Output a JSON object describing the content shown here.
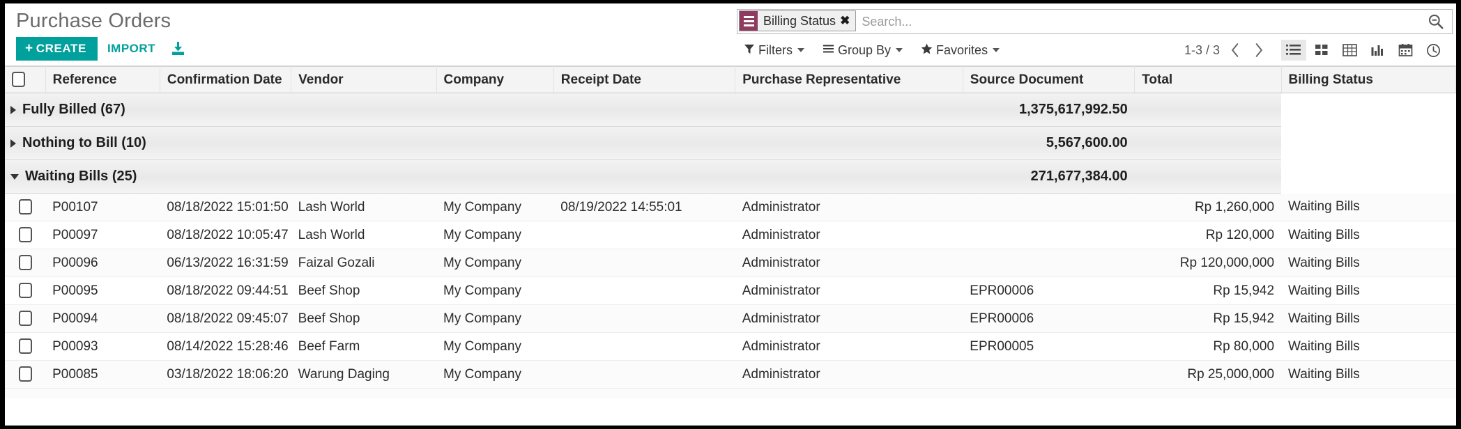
{
  "header": {
    "title": "Purchase Orders",
    "create_label": "CREATE",
    "create_plus": "+",
    "import_label": "IMPORT",
    "download_icon": "download-icon",
    "accent_color": "#00a09d"
  },
  "search": {
    "facet": {
      "label": "Billing Status",
      "remove": "✖",
      "icon": "group-by-icon",
      "icon_color": "#8f3a5f"
    },
    "placeholder": "Search...",
    "value": "",
    "magnifier_icon": "search-icon"
  },
  "toolbar": {
    "filters_label": "Filters",
    "filters_icon": "filter-funnel-icon",
    "groupby_label": "Group By",
    "groupby_icon": "group-by-icon",
    "favorites_label": "Favorites",
    "favorites_icon": "star-icon",
    "pager_range": "1-3 / 3",
    "prev_icon": "chevron-left-icon",
    "next_icon": "chevron-right-icon",
    "views": [
      {
        "name": "list-view-button",
        "icon": "list-icon",
        "active": true
      },
      {
        "name": "kanban-view-button",
        "icon": "kanban-icon",
        "active": false
      },
      {
        "name": "pivot-view-button",
        "icon": "pivot-table-icon",
        "active": false
      },
      {
        "name": "graph-view-button",
        "icon": "bar-chart-icon",
        "active": false
      },
      {
        "name": "calendar-view-button",
        "icon": "calendar-icon",
        "active": false
      },
      {
        "name": "activity-view-button",
        "icon": "clock-icon",
        "active": false
      }
    ]
  },
  "table": {
    "columns": [
      "Reference",
      "Confirmation Date",
      "Vendor",
      "Company",
      "Receipt Date",
      "Purchase Representative",
      "Source Document",
      "Total",
      "Billing Status"
    ],
    "groups": [
      {
        "label": "Fully Billed (67)",
        "total": "1,375,617,992.50",
        "expanded": false
      },
      {
        "label": "Nothing to Bill (10)",
        "total": "5,567,600.00",
        "expanded": false
      },
      {
        "label": "Waiting Bills (25)",
        "total": "271,677,384.00",
        "expanded": true
      }
    ],
    "rows": [
      {
        "reference": "P00107",
        "confirmation_date": "08/18/2022 15:01:50",
        "vendor": "Lash World",
        "company": "My Company",
        "receipt_date": "08/19/2022 14:55:01",
        "purchase_representative": "Administrator",
        "source_document": "",
        "total": "Rp 1,260,000",
        "billing_status": "Waiting Bills"
      },
      {
        "reference": "P00097",
        "confirmation_date": "08/18/2022 10:05:47",
        "vendor": "Lash World",
        "company": "My Company",
        "receipt_date": "",
        "purchase_representative": "Administrator",
        "source_document": "",
        "total": "Rp 120,000",
        "billing_status": "Waiting Bills"
      },
      {
        "reference": "P00096",
        "confirmation_date": "06/13/2022 16:31:59",
        "vendor": "Faizal Gozali",
        "company": "My Company",
        "receipt_date": "",
        "purchase_representative": "Administrator",
        "source_document": "",
        "total": "Rp 120,000,000",
        "billing_status": "Waiting Bills"
      },
      {
        "reference": "P00095",
        "confirmation_date": "08/18/2022 09:44:51",
        "vendor": "Beef Shop",
        "company": "My Company",
        "receipt_date": "",
        "purchase_representative": "Administrator",
        "source_document": "EPR00006",
        "total": "Rp 15,942",
        "billing_status": "Waiting Bills"
      },
      {
        "reference": "P00094",
        "confirmation_date": "08/18/2022 09:45:07",
        "vendor": "Beef Shop",
        "company": "My Company",
        "receipt_date": "",
        "purchase_representative": "Administrator",
        "source_document": "EPR00006",
        "total": "Rp 15,942",
        "billing_status": "Waiting Bills"
      },
      {
        "reference": "P00093",
        "confirmation_date": "08/14/2022 15:28:46",
        "vendor": "Beef Farm",
        "company": "My Company",
        "receipt_date": "",
        "purchase_representative": "Administrator",
        "source_document": "EPR00005",
        "total": "Rp 80,000",
        "billing_status": "Waiting Bills"
      },
      {
        "reference": "P00085",
        "confirmation_date": "03/18/2022 18:06:20",
        "vendor": "Warung Daging",
        "company": "My Company",
        "receipt_date": "",
        "purchase_representative": "Administrator",
        "source_document": "",
        "total": "Rp 25,000,000",
        "billing_status": "Waiting Bills"
      }
    ]
  }
}
